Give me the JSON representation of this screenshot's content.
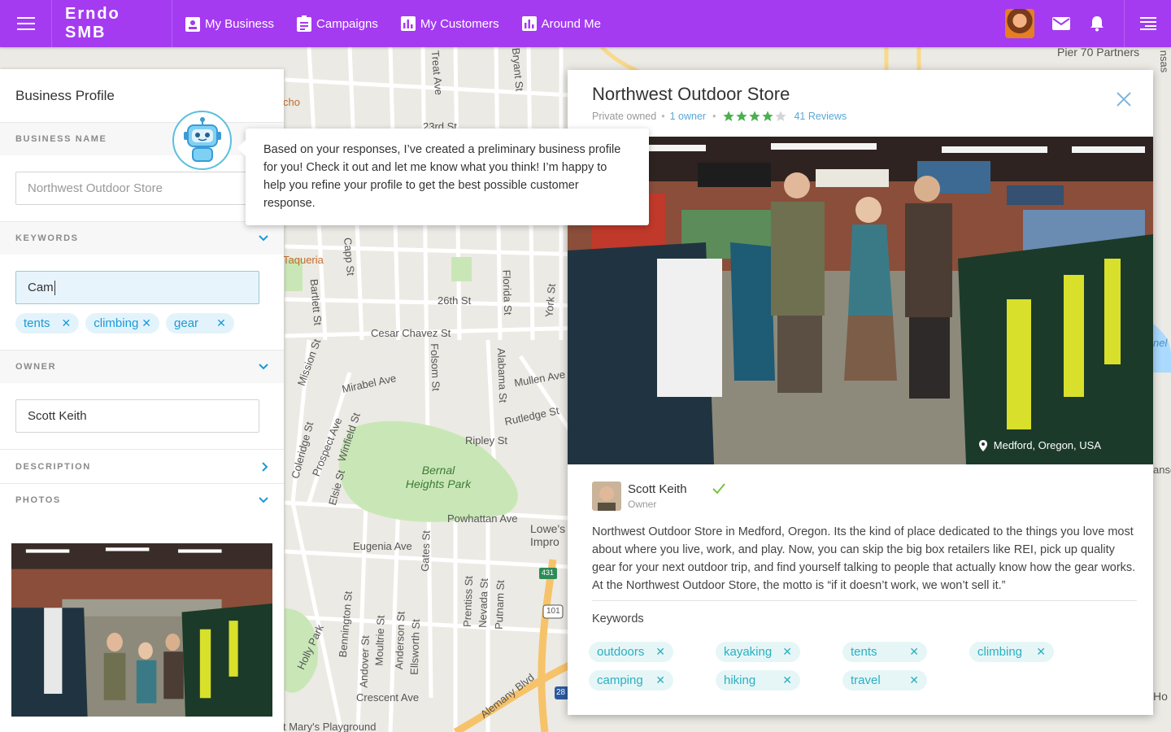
{
  "app": {
    "brand": "Erndo SMB",
    "nav": [
      {
        "label": "My Business",
        "icon": "store-icon"
      },
      {
        "label": "Campaigns",
        "icon": "clipboard-icon"
      },
      {
        "label": "My Customers",
        "icon": "bar-chart-icon"
      },
      {
        "label": "Around Me",
        "icon": "bar-chart-icon"
      }
    ],
    "colors": {
      "topbar": "#a43bf0",
      "chip_text": "#1a9ad6",
      "keyword_chip_text": "#2bb0c1",
      "star": "#4caf50",
      "verified": "#7cc142"
    }
  },
  "map": {
    "labels": {
      "pier": "Pier 70 Partners",
      "taqueria": "Taqueria",
      "cho": "cho",
      "street_26th": "26th St",
      "street_23rd": "23rd St",
      "cesar_chavez": "Cesar Chavez St",
      "mirabel": "Mirabel Ave",
      "mullen": "Mullen Ave",
      "rutledge": "Rutledge St",
      "ripley": "Ripley St",
      "bernal": "Bernal Heights Park",
      "powhattan": "Powhattan Ave",
      "eugenia": "Eugenia Ave",
      "crescent": "Crescent Ave",
      "playground": "t Mary's Playground",
      "lowes": "Lowe's Impro",
      "hwy431": "431",
      "hwy101": "101",
      "hwy280": "28",
      "alemany": "Alemany Blvd",
      "ho": "Ho",
      "bartlett": "Bartlett St",
      "capp": "Capp St",
      "treat": "Treat Ave",
      "folsom": "Folsom St",
      "florida": "Florida St",
      "york": "York St",
      "bryant": "Bryant St",
      "alabama": "Alabama St",
      "mission": "Mission St",
      "coleridge": "Coleridge St",
      "prospect": "Prospect Ave",
      "winfield": "Winfield St",
      "elsie": "Elsie St",
      "gates": "Gates St",
      "bennington": "Bennington St",
      "andover": "Andover St",
      "moultrie": "Moultrie St",
      "anderson": "Anderson St",
      "ellsworth": "Ellsworth St",
      "prentiss": "Prentiss St",
      "nevada": "Nevada St",
      "putnam": "Putnam St",
      "holly": "Holly Park",
      "nsas": "nsas",
      "ansc": "ansc",
      "nel": "nel"
    }
  },
  "left_panel": {
    "title": "Business Profile",
    "business_name": {
      "label": "BUSINESS NAME",
      "placeholder": "Northwest Outdoor Store"
    },
    "keywords": {
      "label": "KEYWORDS",
      "input_value": "Cam",
      "chips": [
        "tents",
        "climbing",
        "gear"
      ]
    },
    "owner": {
      "label": "OWNER",
      "value": "Scott Keith"
    },
    "description": {
      "label": "DESCRIPTION"
    },
    "photos": {
      "label": "PHOTOS"
    }
  },
  "assistant": {
    "message": "Based on your responses, I’ve created a preliminary business profile for you! Check it out and let me know what you think! I’m happy to help you refine your profile to get the best possible customer response."
  },
  "card": {
    "title": "Northwest Outdoor Store",
    "ownership": "Private owned",
    "owners": "1 owner",
    "rating": 4,
    "rating_max": 5,
    "reviews": "41 Reviews",
    "location": "Medford, Oregon, USA",
    "owner_name": "Scott Keith",
    "owner_role": "Owner",
    "description": "Northwest Outdoor Store in Medford, Oregon. Its the kind of place dedicated to the things you love most about where you live, work, and play. Now, you can skip the big box retailers like REI, pick up quality gear for your next outdoor trip, and find yourself talking to people that actually know how the gear works. At the Northwest Outdoor Store, the motto is “if it doesn’t work, we won’t sell it.”",
    "keywords_label": "Keywords",
    "keywords": [
      "outdoors",
      "kayaking",
      "tents",
      "climbing",
      "camping",
      "hiking",
      "travel"
    ]
  }
}
